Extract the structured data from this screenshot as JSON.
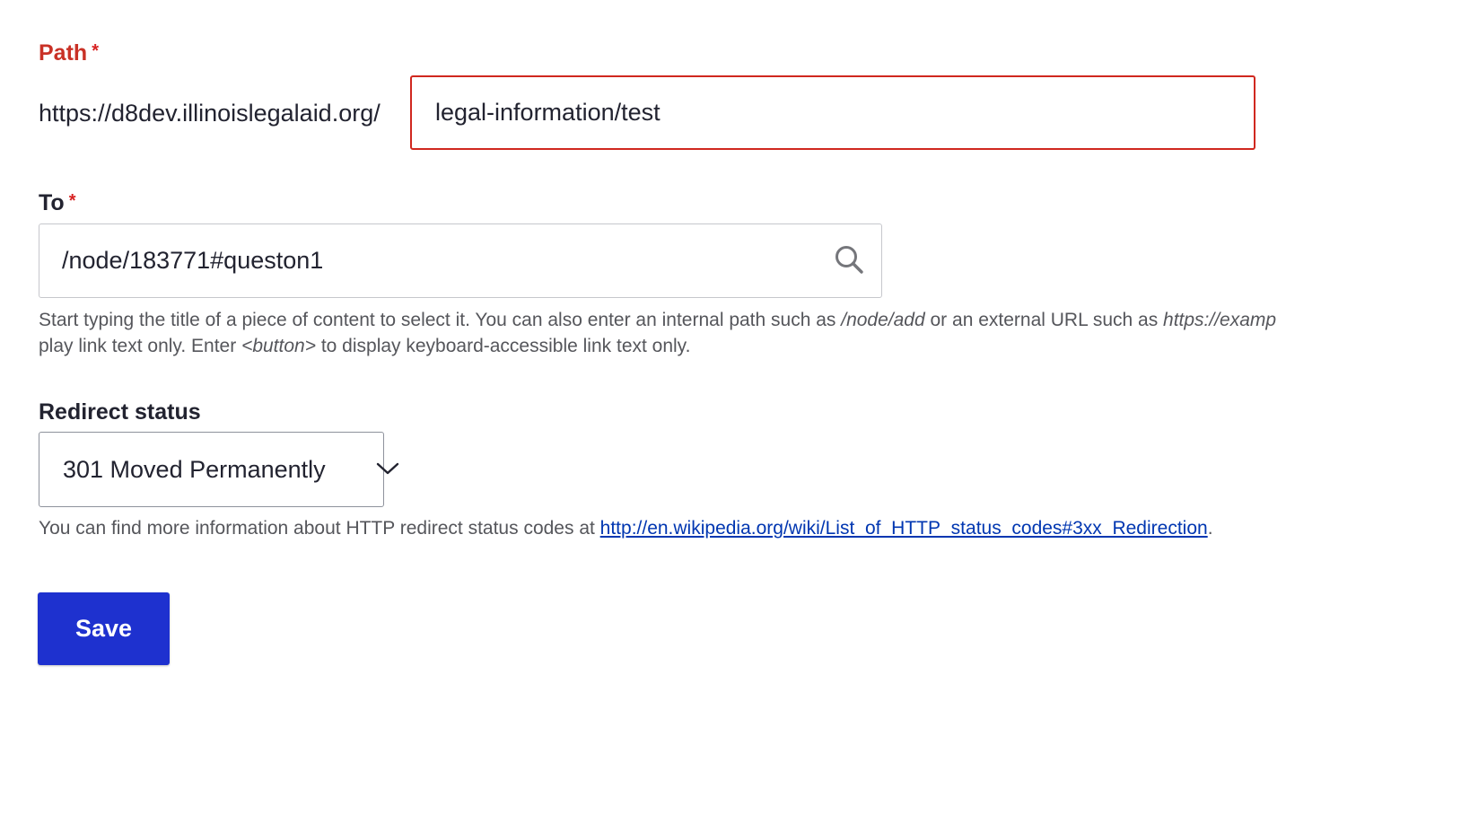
{
  "path": {
    "label": "Path",
    "required_marker": "*",
    "prefix": "https://d8dev.illinoislegalaid.org/",
    "value": "legal-information/test"
  },
  "to": {
    "label": "To",
    "required_marker": "*",
    "value": "/node/183771#queston1",
    "description": {
      "line1_a": "Start typing the title of a piece of content to select it. You can also enter an internal path such as ",
      "line1_em1": "/node/add",
      "line1_b": " or an external URL such as ",
      "line1_em2": "https://examp",
      "line2_a": "play link text only. Enter ",
      "line2_em": "<button>",
      "line2_b": " to display keyboard-accessible link text only."
    }
  },
  "redirect_status": {
    "label": "Redirect status",
    "selected": "301 Moved Permanently",
    "description_prefix": "You can find more information about HTTP redirect status codes at ",
    "description_link": "http://en.wikipedia.org/wiki/List_of_HTTP_status_codes#3xx_Redirection",
    "description_suffix": "."
  },
  "actions": {
    "save_label": "Save"
  },
  "colors": {
    "error": "#d0281f",
    "primary_button": "#1e31cf",
    "link": "#0036b1"
  },
  "icons": {
    "to_field": "search-icon",
    "select": "chevron-down-icon"
  }
}
